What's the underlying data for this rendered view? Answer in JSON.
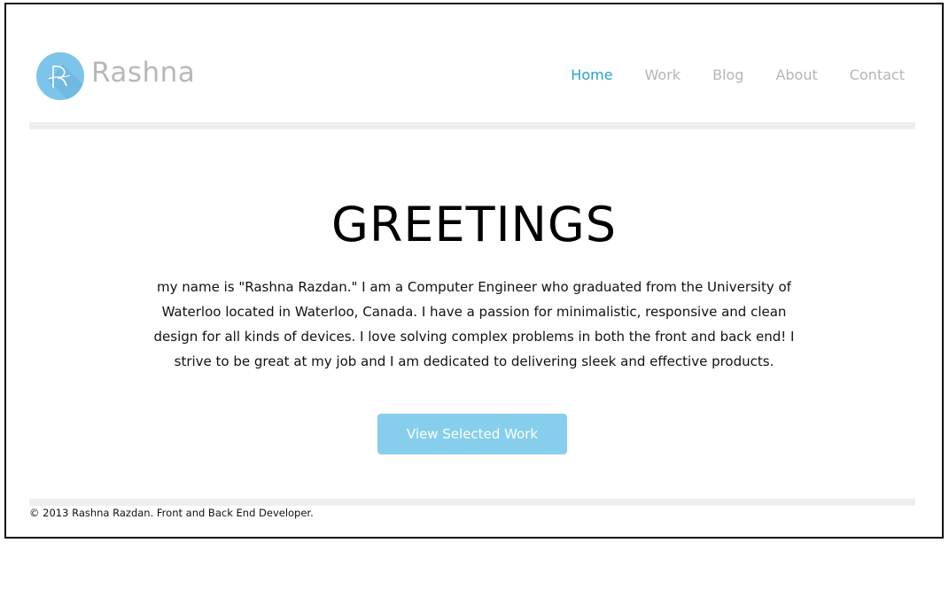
{
  "brand": {
    "name": "Rashna",
    "logo_icon": "r-monogram-icon",
    "accent_color": "#2ba0d0",
    "logo_color": "#7cc4ea"
  },
  "nav": {
    "items": [
      {
        "label": "Home",
        "active": true
      },
      {
        "label": "Work",
        "active": false
      },
      {
        "label": "Blog",
        "active": false
      },
      {
        "label": "About",
        "active": false
      },
      {
        "label": "Contact",
        "active": false
      }
    ]
  },
  "hero": {
    "title": "GREETINGS",
    "body": "my name is \"Rashna Razdan.\" I am a Computer Engineer who graduated from the University of Waterloo located in Waterloo, Canada. I have a passion for minimalistic, responsive and clean design for all kinds of devices. I love solving complex problems in both the front and back end! I strive to be great at my job and I am dedicated to delivering sleek and effective products.",
    "cta_label": "View Selected Work",
    "cta_color": "#87ceed"
  },
  "footer": {
    "text": "© 2013 Rashna Razdan. Front and Back End Developer."
  }
}
